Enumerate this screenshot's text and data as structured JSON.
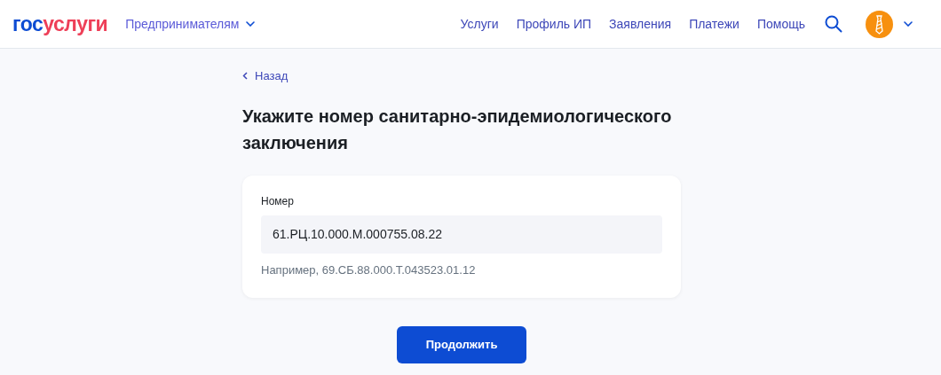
{
  "header": {
    "logo": [
      "гос",
      "услуги"
    ],
    "audience": "Предпринимателям",
    "nav": [
      "Услуги",
      "Профиль ИП",
      "Заявления",
      "Платежи",
      "Помощь"
    ]
  },
  "back": "Назад",
  "title": "Укажите номер санитарно-эпидемиологического заключения",
  "field": {
    "label": "Номер",
    "value": "61.РЦ.10.000.М.000755.08.22",
    "hint": "Например, 69.СБ.88.000.Т.043523.01.12"
  },
  "submit": "Продолжить"
}
